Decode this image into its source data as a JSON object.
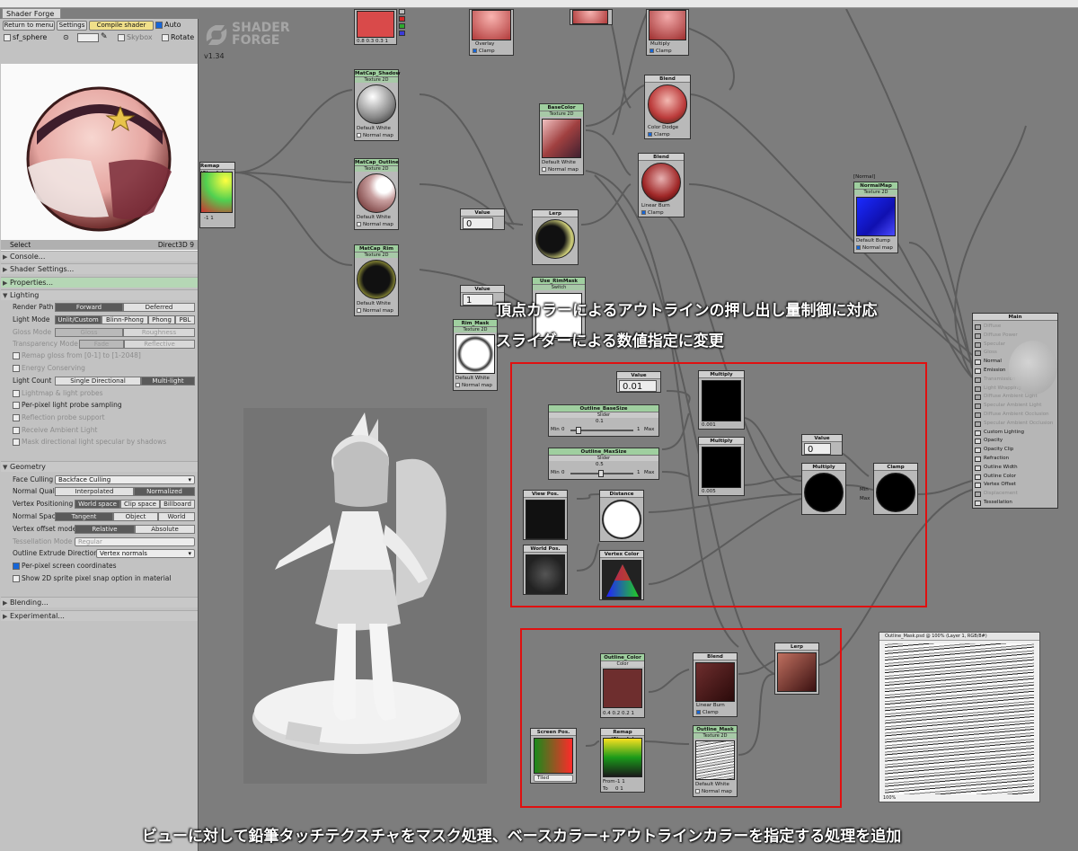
{
  "window": {
    "tab_title": "Shader Forge"
  },
  "toolbar": {
    "return_label": "Return to menu",
    "settings_label": "Settings",
    "compile_label": "Compile shader",
    "auto_label": "Auto",
    "auto_checked": true
  },
  "preview_bar": {
    "mesh_label": "sf_sphere",
    "skybox_label": "Skybox",
    "rotate_label": "Rotate"
  },
  "select_bar": {
    "select_label": "Select",
    "renderer_label": "Direct3D 9"
  },
  "sections": {
    "console": "Console...",
    "shader_settings": "Shader Settings...",
    "properties": "Properties...",
    "lighting": "Lighting",
    "geometry": "Geometry",
    "blending": "Blending...",
    "experimental": "Experimental..."
  },
  "lighting": {
    "render_path_label": "Render Path",
    "render_path_options": [
      "Forward",
      "Deferred"
    ],
    "light_mode_label": "Light Mode",
    "light_mode_options": [
      "Unlit/Custom",
      "Blinn-Phong",
      "Phong",
      "PBL"
    ],
    "gloss_mode_label": "Gloss Mode",
    "gloss_mode_options": [
      "Gloss",
      "Roughness"
    ],
    "transparency_mode_label": "Transparency Mode",
    "transparency_mode_options": [
      "Fade",
      "Reflective"
    ],
    "remap_gloss": "Remap gloss from [0-1] to [1-2048]",
    "energy_conserving": "Energy Conserving",
    "light_count_label": "Light Count",
    "light_count_options": [
      "Single Directional",
      "Multi-light"
    ],
    "lightmap_probes": "Lightmap & light probes",
    "per_pixel_probe": "Per-pixel light probe sampling",
    "reflection_probe": "Reflection probe support",
    "receive_ambient": "Receive Ambient Light",
    "mask_directional": "Mask directional light specular by shadows"
  },
  "geometry": {
    "face_culling_label": "Face Culling",
    "face_culling_value": "Backface Culling",
    "normal_quality_label": "Normal Quality",
    "normal_quality_options": [
      "Interpolated",
      "Normalized"
    ],
    "vertex_positioning_label": "Vertex Positioning",
    "vertex_positioning_options": [
      "World space",
      "Clip space",
      "Billboard"
    ],
    "normal_space_label": "Normal Space",
    "normal_space_options": [
      "Tangent",
      "Object",
      "World"
    ],
    "vertex_offset_label": "Vertex offset mode",
    "vertex_offset_options": [
      "Relative",
      "Absolute"
    ],
    "tessellation_mode_label": "Tessellation Mode",
    "tessellation_mode_value": "Regular",
    "outline_extrude_label": "Outline Extrude Direction",
    "outline_extrude_value": "Vertex normals",
    "per_pixel_screen": "Per-pixel screen coordinates",
    "sprite_snap": "Show 2D sprite pixel snap option in material"
  },
  "logo": {
    "line1": "SHADER",
    "line2": "FORGE",
    "version": "v1.34"
  },
  "nodes": {
    "color_top": "0.8  0.3  0.3  1",
    "overlay": "Overlay",
    "multiply_top": "Multiply",
    "clamp": "Clamp",
    "matcap_shadow": "MatCap_Shadow",
    "texture2d": "Texture 2D",
    "default": "Default",
    "white": "White",
    "normal_map": "Normal map",
    "matcap_outline": "MatCap_Outline",
    "matcap_rim": "MatCap_Rim",
    "remap_simple": "Remap (Simple)",
    "remap_vals": "-1   1",
    "basecolor": "BaseColor",
    "blend": "Blend",
    "color_dodge": "Color Dodge",
    "linear_burn": "Linear Burn",
    "value": "Value",
    "value_zero": "0",
    "value_one": "1",
    "lerp": "Lerp",
    "use_rimmask": "Use_RimMask",
    "switch": "Switch",
    "rim_mask": "Rim_Mask",
    "normal_label": "[Normal]",
    "normalmap": "NormalMap",
    "bump": "Bump",
    "value_001": "0.01",
    "multiply": "Multiply",
    "mult_readout_1": "0.001",
    "mult_readout_2": "0.005",
    "outline_basesize": "Outline_BaseSize",
    "slider": "Slider",
    "basesize_val": "0.1",
    "outline_maxsize": "Outline_MaxSize",
    "maxsize_val": "0.5",
    "min_label": "Min",
    "max_label": "Max",
    "slider_min": "0",
    "slider_max": "1",
    "view_pos": "View Pos.",
    "distance": "Distance",
    "world_pos": "World Pos.",
    "vertex_color": "Vertex Color",
    "clamp_node": "Clamp",
    "outline_color": "Outline_Color",
    "color": "Color",
    "outline_color_vals": "0.4  0.2  0.2  1",
    "outline_mask": "Outline_Mask",
    "screen_pos": "Screen Pos.",
    "tiled": "Tiled",
    "remap_from": "From",
    "remap_to": "To",
    "remap_from_vals": "-1    1",
    "remap_to_vals": "0    1",
    "main": "Main"
  },
  "main_inputs": [
    "Diffuse",
    "Diffuse Power",
    "Specular",
    "Gloss",
    "Normal",
    "Emission",
    "Transmission",
    "Light Wrapping",
    "Diffuse Ambient Light",
    "Specular Ambient Light",
    "Diffuse Ambient Occlusion",
    "Specular Ambient Occlusion",
    "Custom Lighting",
    "Opacity",
    "Opacity Clip",
    "Refraction",
    "Outline Width",
    "Outline Color",
    "Vertex Offset",
    "Displacement",
    "Tessellation"
  ],
  "main_inputs_active": [
    false,
    false,
    false,
    false,
    true,
    true,
    false,
    false,
    false,
    false,
    false,
    false,
    true,
    true,
    true,
    true,
    true,
    true,
    true,
    false,
    true
  ],
  "image_viewer": {
    "title": "Outline_Mask.psd @ 100% (Layer 1, RGB/8#)",
    "zoom": "100%"
  },
  "annotations": {
    "top_line1": "頂点カラーによるアウトラインの押し出し量制御に対応",
    "top_line2": "スライダーによる数値指定に変更",
    "bottom": "ビューに対して鉛筆タッチテクスチャをマスク処理、ベースカラー+アウトラインカラーを指定する処理を追加"
  },
  "colors": {
    "red_box": "#e01010",
    "accent_green": "#9fcf9f",
    "port_red": "#d42828",
    "port_green": "#2ea82e",
    "port_blue": "#3a3ad8"
  }
}
